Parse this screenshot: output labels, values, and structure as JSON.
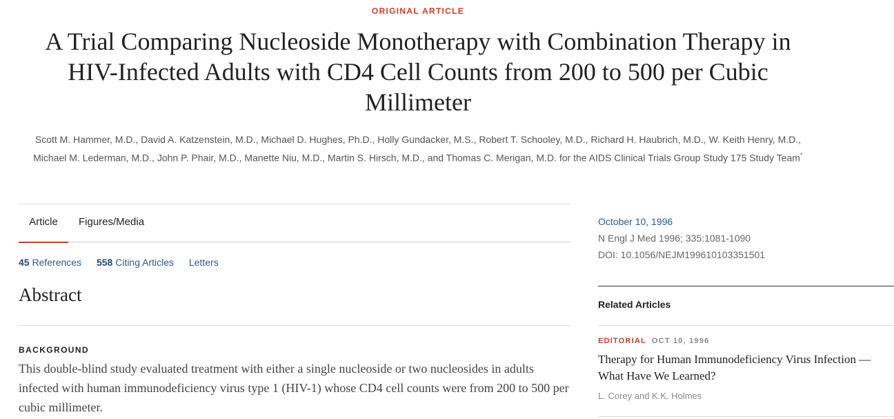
{
  "article": {
    "kicker": "ORIGINAL ARTICLE",
    "title": "A Trial Comparing Nucleoside Monotherapy with Combination Therapy in HIV-Infected Adults with CD4 Cell Counts from 200 to 500 per Cubic Millimeter",
    "authors": "Scott M. Hammer, M.D., David A. Katzenstein, M.D., Michael D. Hughes, Ph.D., Holly Gundacker, M.S., Robert T. Schooley, M.D., Richard H. Haubrich, M.D., W. Keith Henry, M.D., Michael M. Lederman, M.D., John P. Phair, M.D., Manette Niu, M.D., Martin S. Hirsch, M.D., and Thomas C. Merigan, M.D. for the AIDS Clinical Trials Group Study 175 Study Team",
    "authors_marker": "*"
  },
  "tabs": [
    {
      "label": "Article",
      "active": true
    },
    {
      "label": "Figures/Media",
      "active": false
    }
  ],
  "links": {
    "references_count": "45",
    "references_label": "References",
    "citing_count": "558",
    "citing_label": "Citing Articles",
    "letters_label": "Letters"
  },
  "abstract": {
    "heading": "Abstract",
    "section_label": "BACKGROUND",
    "background": "This double-blind study evaluated treatment with either a single nucleoside or two nucleosides in adults infected with human immunodeficiency virus type 1 (HIV-1) whose CD4 cell counts were from 200 to 500 per cubic millimeter."
  },
  "meta": {
    "date": "October 10, 1996",
    "citation": "N Engl J Med 1996; 335:1081-1090",
    "doi": "DOI: 10.1056/NEJM199610103351501"
  },
  "related": {
    "heading": "Related Articles",
    "item": {
      "type": "EDITORIAL",
      "date": "OCT 10, 1996",
      "title": "Therapy for Human Immunodeficiency Virus Infection — What Have We Learned?",
      "authors": "L. Corey and K.K. Holmes"
    }
  },
  "colors": {
    "accent": "#c9402c",
    "link": "#2a5c8a"
  }
}
